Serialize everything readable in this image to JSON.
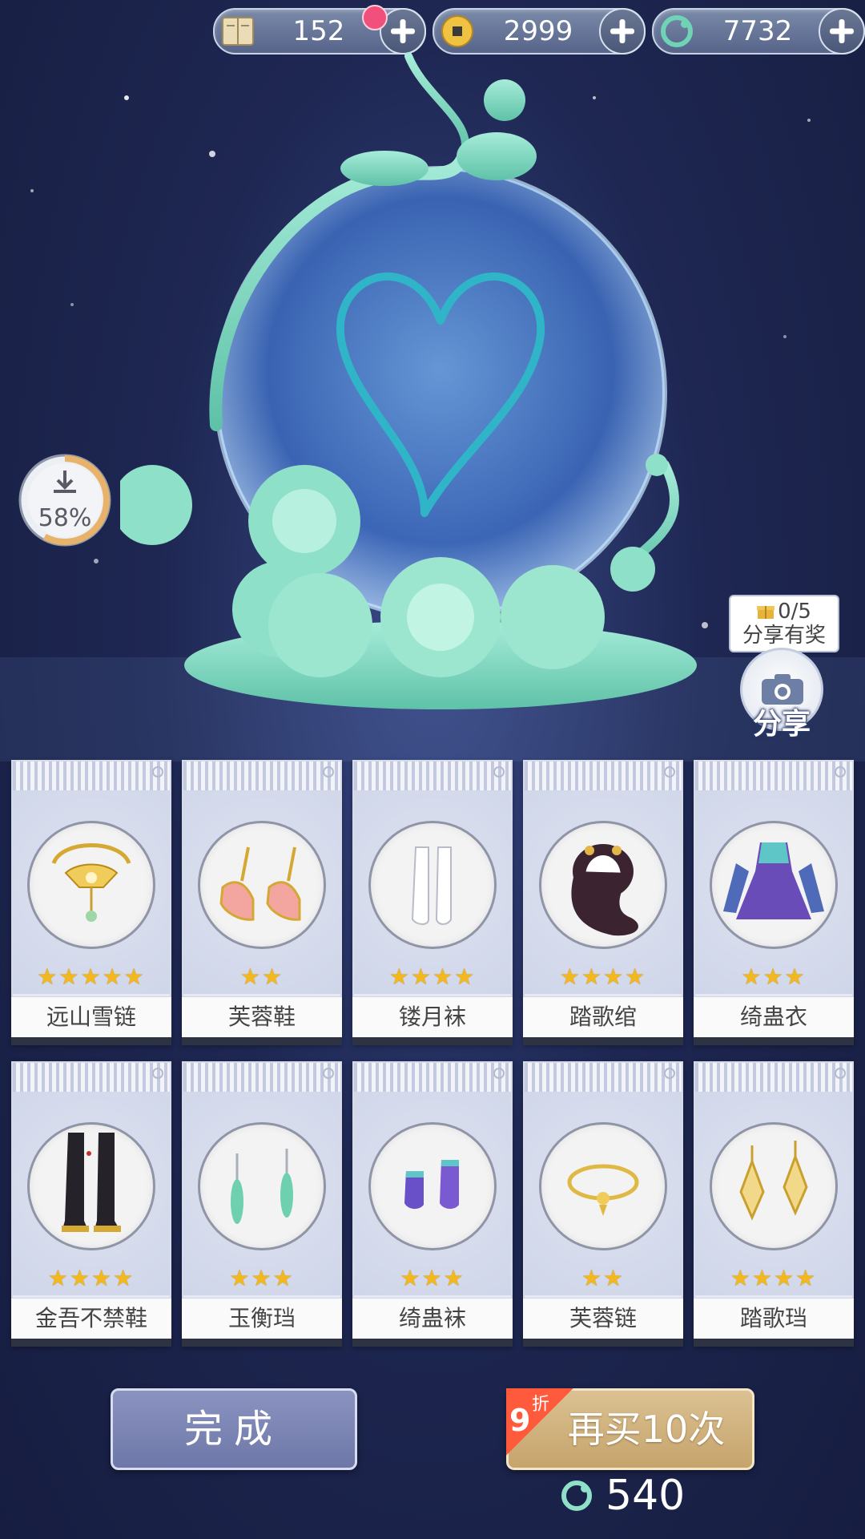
{
  "currencies": [
    {
      "icon": "book-icon",
      "value": "152",
      "has_notification": true
    },
    {
      "icon": "coin-icon",
      "value": "2999",
      "has_notification": false
    },
    {
      "icon": "jade-icon",
      "value": "7732",
      "has_notification": false
    }
  ],
  "download": {
    "icon": "download-icon",
    "progress_percent": 58,
    "label": "58%"
  },
  "share": {
    "reward_counter": "0/5",
    "reward_text": "分享有奖",
    "button_label": "分享",
    "icon": "camera-icon"
  },
  "items_row1": [
    {
      "name": "远山雪链",
      "stars": 5,
      "stars_text": "★★★★★",
      "icon": "necklace-icon"
    },
    {
      "name": "芙蓉鞋",
      "stars": 2,
      "stars_text": "★★",
      "icon": "shoes-icon"
    },
    {
      "name": "镂月袜",
      "stars": 4,
      "stars_text": "★★★★",
      "icon": "socks-icon"
    },
    {
      "name": "踏歌绾",
      "stars": 4,
      "stars_text": "★★★★",
      "icon": "hairstyle-icon"
    },
    {
      "name": "绮蛊衣",
      "stars": 3,
      "stars_text": "★★★",
      "icon": "dress-icon"
    }
  ],
  "items_row2": [
    {
      "name": "金吾不禁鞋",
      "stars": 4,
      "stars_text": "★★★★",
      "icon": "boots-icon"
    },
    {
      "name": "玉衡珰",
      "stars": 3,
      "stars_text": "★★★",
      "icon": "jade-earrings-icon"
    },
    {
      "name": "绮蛊袜",
      "stars": 3,
      "stars_text": "★★★",
      "icon": "purple-socks-icon"
    },
    {
      "name": "芙蓉链",
      "stars": 2,
      "stars_text": "★★",
      "icon": "bracelet-icon"
    },
    {
      "name": "踏歌珰",
      "stars": 4,
      "stars_text": "★★★★",
      "icon": "gold-earrings-icon"
    }
  ],
  "actions": {
    "done_label": "完成",
    "buy_again_label": "再买10次",
    "discount_number": "9",
    "discount_unit": "折",
    "cost_value": "540",
    "cost_icon": "jade-icon"
  },
  "colors": {
    "jade": "#7fd8c2",
    "star": "#f2b81d",
    "done_button": "#7e88b8",
    "buy_button": "#cfb07a",
    "discount": "#ff5a3c"
  }
}
